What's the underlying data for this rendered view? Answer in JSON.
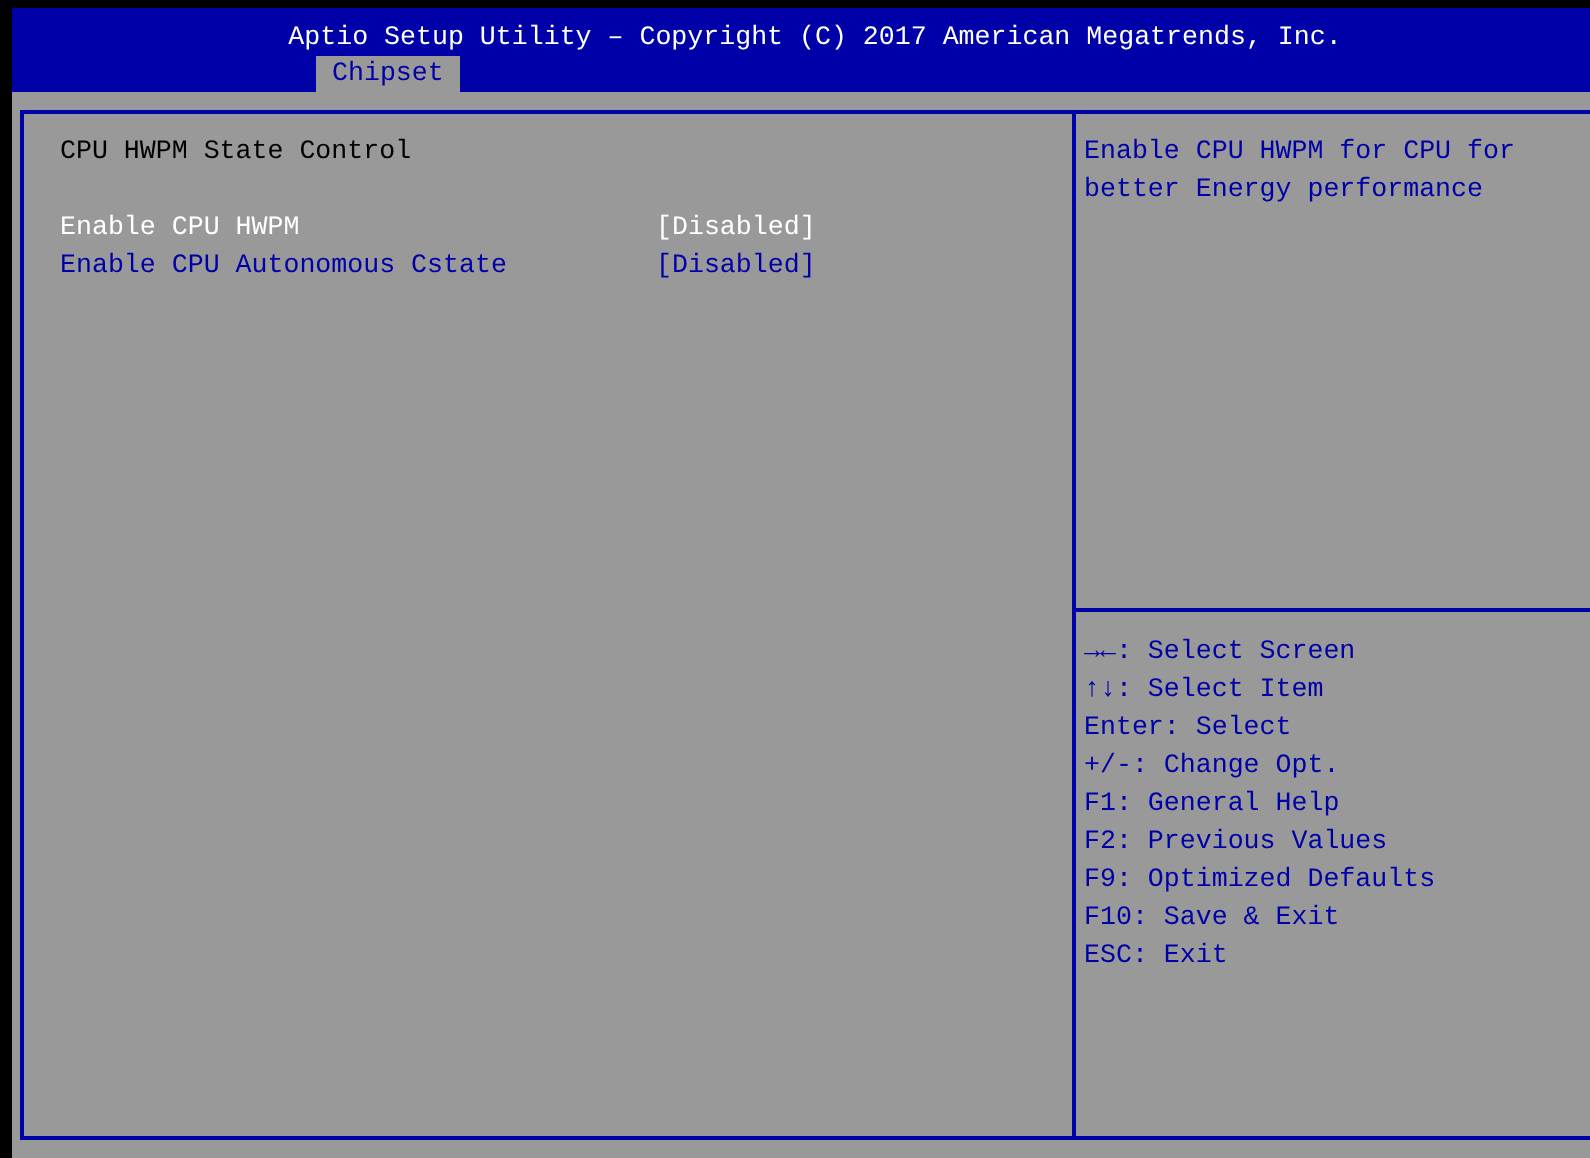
{
  "header": {
    "title": "Aptio Setup Utility – Copyright (C) 2017 American Megatrends, Inc."
  },
  "tabs": [
    {
      "label": "Chipset",
      "selected": true
    }
  ],
  "main": {
    "heading": "CPU HWPM State Control",
    "options": [
      {
        "label": "Enable CPU HWPM",
        "value": "[Disabled]",
        "selected": true
      },
      {
        "label": "Enable CPU Autonomous Cstate",
        "value": "[Disabled]",
        "selected": false
      }
    ]
  },
  "help": {
    "text": [
      "Enable CPU HWPM for CPU for",
      "better Energy performance"
    ]
  },
  "keys": [
    {
      "key": "→←",
      "action": ": Select Screen"
    },
    {
      "key": "↑↓",
      "action": ": Select Item"
    },
    {
      "key": "Enter",
      "action": ": Select"
    },
    {
      "key": "+/-",
      "action": ": Change Opt."
    },
    {
      "key": "F1",
      "action": ": General Help"
    },
    {
      "key": "F2",
      "action": ": Previous Values"
    },
    {
      "key": "F9",
      "action": ": Optimized Defaults"
    },
    {
      "key": "F10",
      "action": ": Save & Exit"
    },
    {
      "key": "ESC",
      "action": ": Exit"
    }
  ]
}
